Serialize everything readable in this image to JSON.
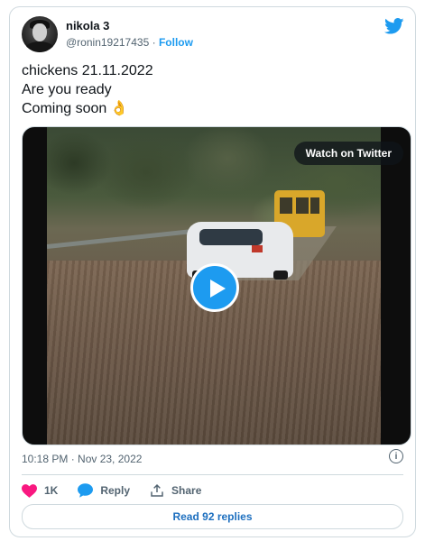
{
  "tweet": {
    "author_name": "nikola 3",
    "handle": "@ronin19217435",
    "separator": "·",
    "follow_label": "Follow",
    "text_lines": [
      "chickens 21.11.2022",
      "Are you ready",
      "Coming soon"
    ],
    "emoji": "👌",
    "timestamp": "10:18 PM · Nov 23, 2022",
    "info_glyph": "i"
  },
  "media": {
    "watch_label": "Watch on Twitter",
    "play_icon": "play-icon"
  },
  "actions": {
    "like_count": "1K",
    "reply_label": "Reply",
    "share_label": "Share"
  },
  "footer": {
    "read_replies_label": "Read 92 replies"
  },
  "colors": {
    "brand_blue": "#1d9bf0",
    "like_pink": "#f91880",
    "muted_text": "#536471",
    "border": "#cfd9de"
  }
}
